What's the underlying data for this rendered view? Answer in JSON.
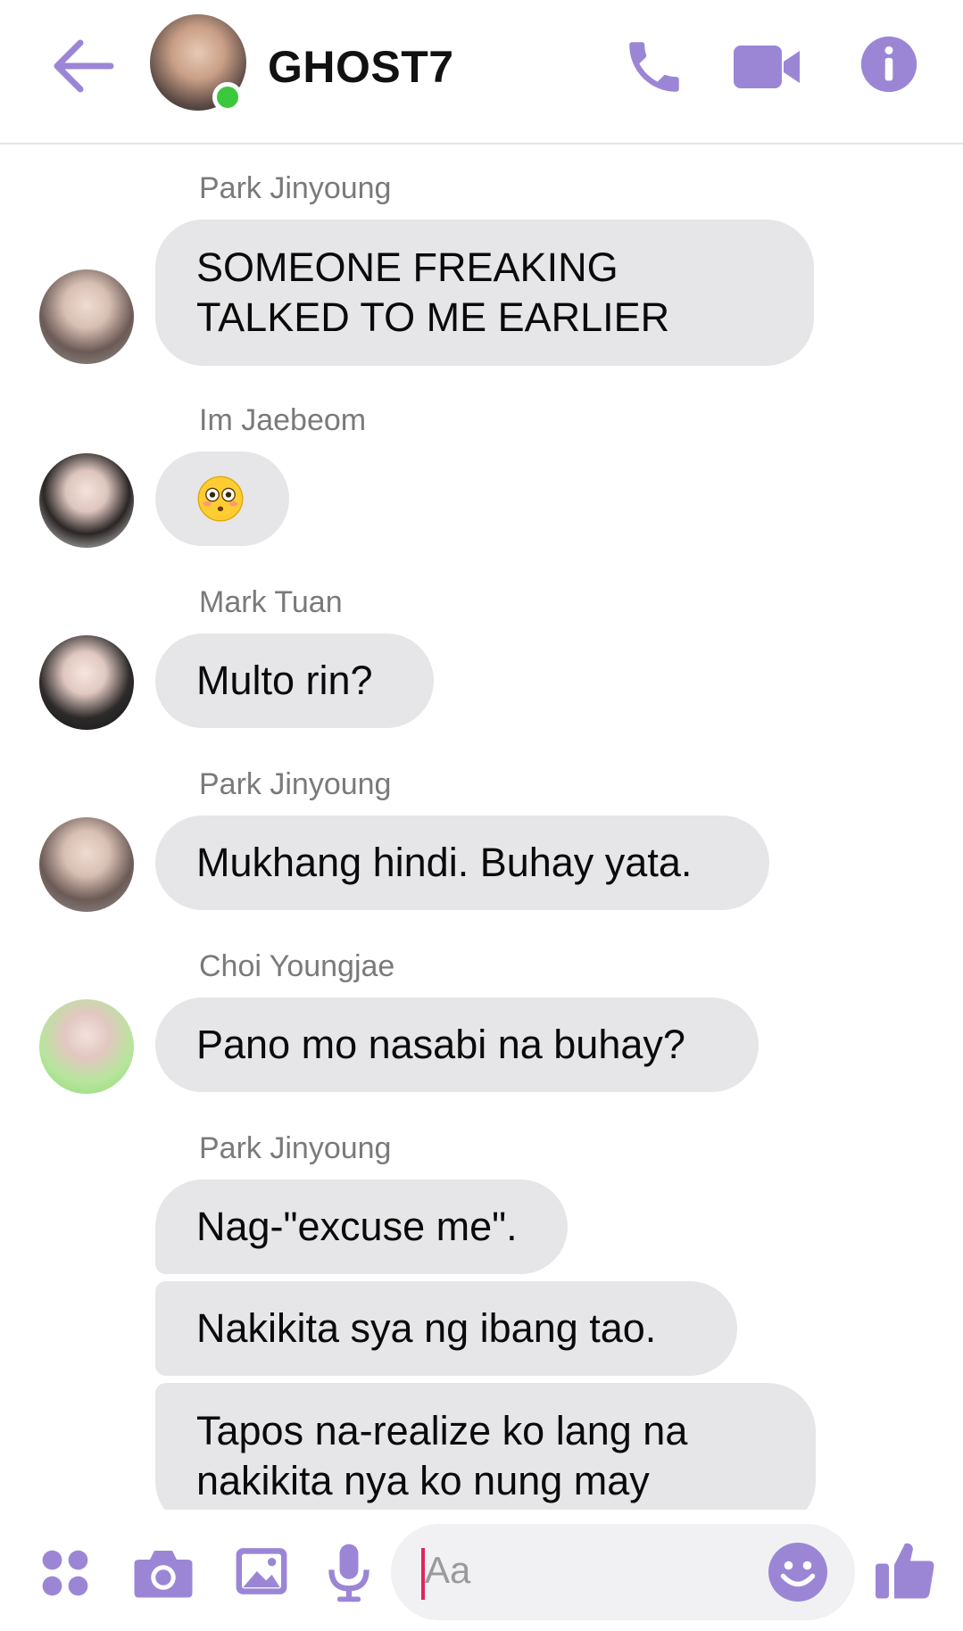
{
  "header": {
    "title": "GHOST7",
    "online": true,
    "accent_color": "#9b86d6"
  },
  "messages": [
    {
      "sender": "Park Jinyoung",
      "avatar": "park",
      "bubbles": [
        "SOMEONE FREAKING TALKED TO ME EARLIER"
      ]
    },
    {
      "sender": "Im Jaebeom",
      "avatar": "im",
      "bubbles": [
        "😳"
      ]
    },
    {
      "sender": "Mark Tuan",
      "avatar": "mark",
      "bubbles": [
        "Multo rin?"
      ]
    },
    {
      "sender": "Park Jinyoung",
      "avatar": "park",
      "bubbles": [
        "Mukhang hindi. Buhay yata."
      ]
    },
    {
      "sender": "Choi Youngjae",
      "avatar": "choi",
      "bubbles": [
        "Pano mo nasabi na buhay?"
      ]
    },
    {
      "sender": "Park Jinyoung",
      "avatar": "park",
      "bubbles": [
        "Nag-\"excuse me\".",
        "Nakikita sya ng ibang tao.",
        "Tapos na-realize ko lang na nakikita nya ko nung may"
      ]
    }
  ],
  "composer": {
    "placeholder": "Aa"
  },
  "icons": {
    "back": "arrow-left-icon",
    "call": "phone-icon",
    "video": "video-camera-icon",
    "info": "info-icon",
    "more": "four-dots-icon",
    "camera": "camera-icon",
    "gallery": "image-icon",
    "mic": "microphone-icon",
    "emoji": "smiley-icon",
    "like": "thumbs-up-icon"
  }
}
